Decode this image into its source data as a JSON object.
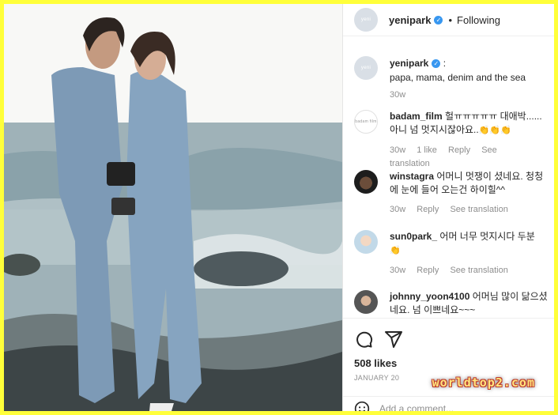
{
  "post": {
    "author": "yenipark",
    "follow_status": "Following",
    "dot": "•",
    "caption_colon": ":",
    "caption": "papa, mama, denim and the sea",
    "caption_time": "30w"
  },
  "comments": [
    {
      "user": "badam_film",
      "text": "헐ㅠㅠㅠㅠㅠ 대애박......아니 넘 멋지시잖아요..",
      "claps": "👏👏👏",
      "time": "30w",
      "likes": "1 like",
      "reply": "Reply",
      "translate": "See translation",
      "avatar_text": "badam film"
    },
    {
      "user": "winstagra",
      "text": "어머니 멋쟁이 셨네요. 청청에 눈에 들어 오는건 하이힐^^",
      "time": "30w",
      "reply": "Reply",
      "translate": "See translation"
    },
    {
      "user": "sun0park_",
      "text": "어머 너무 멋지시다 두분",
      "claps": "👏",
      "time": "30w",
      "reply": "Reply",
      "translate": "See translation"
    },
    {
      "user": "johnny_yoon4100",
      "text": "어머님 많이 닮으셨네요. 넘 이쁘네요~~~"
    }
  ],
  "actions": {
    "likes": "508 likes",
    "date": "JANUARY 20",
    "comment_placeholder": "Add a comment..."
  },
  "avatar_text": "yeni",
  "watermark": "worldtop2.com",
  "colors": {
    "border": "#ffff3a",
    "verified": "#3897f0",
    "muted": "#8e8e8e"
  }
}
